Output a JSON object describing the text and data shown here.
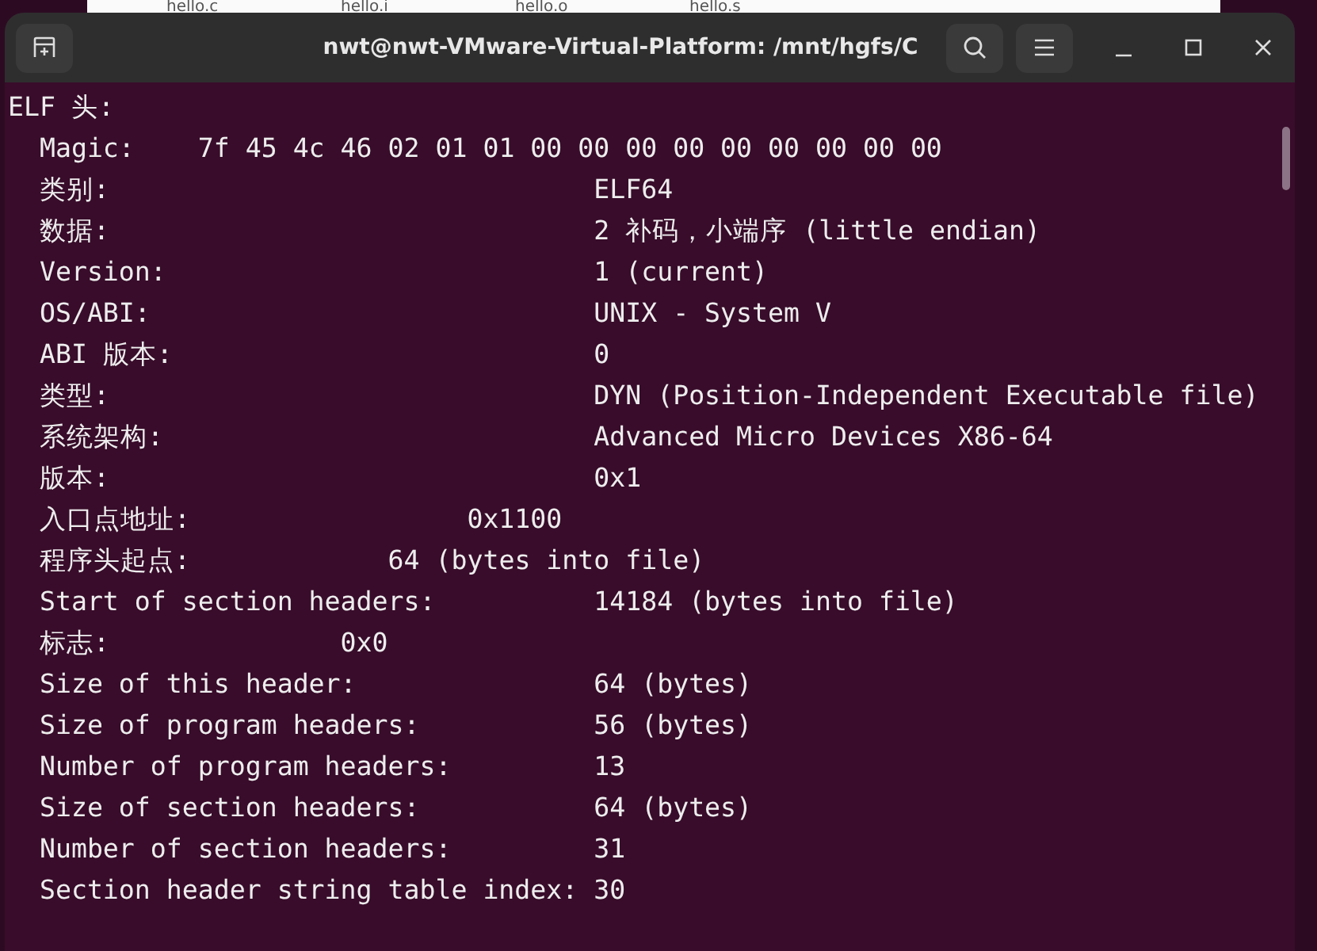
{
  "background_files": [
    "hello.c",
    "hello.i",
    "hello.o",
    "hello.s"
  ],
  "window": {
    "title": "nwt@nwt-VMware-Virtual-Platform: /mnt/hgfs/C"
  },
  "terminal": {
    "heading": "ELF 头:",
    "fields": [
      {
        "label": "Magic:",
        "value": "7f 45 4c 46 02 01 01 00 00 00 00 00 00 00 00 00"
      },
      {
        "label": "类别:",
        "value": "ELF64"
      },
      {
        "label": "数据:",
        "value": "2 补码，小端序 (little endian)"
      },
      {
        "label": "Version:",
        "value": "1 (current)"
      },
      {
        "label": "OS/ABI:",
        "value": "UNIX - System V"
      },
      {
        "label": "ABI 版本:",
        "value": "0"
      },
      {
        "label": "类型:",
        "value": "DYN (Position-Independent Executable file)"
      },
      {
        "label": "系统架构:",
        "value": "Advanced Micro Devices X86-64"
      },
      {
        "label": "版本:",
        "value": "0x1"
      },
      {
        "label": "入口点地址:",
        "value": "0x1100"
      },
      {
        "label": "程序头起点:",
        "value": "64 (bytes into file)"
      },
      {
        "label": "Start of section headers:",
        "value": "14184 (bytes into file)"
      },
      {
        "label": "标志:",
        "value": "0x0"
      },
      {
        "label": "Size of this header:",
        "value": "64 (bytes)"
      },
      {
        "label": "Size of program headers:",
        "value": "56 (bytes)"
      },
      {
        "label": "Number of program headers:",
        "value": "13"
      },
      {
        "label": "Size of section headers:",
        "value": "64 (bytes)"
      },
      {
        "label": "Number of section headers:",
        "value": "31"
      },
      {
        "label": "Section header string table index:",
        "value": "30"
      }
    ]
  }
}
